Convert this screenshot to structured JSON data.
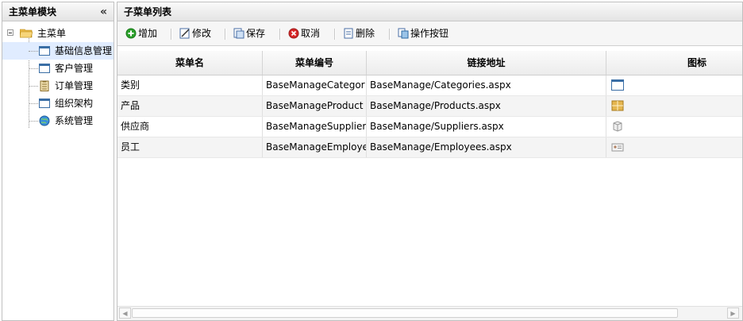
{
  "west": {
    "title": "主菜单模块",
    "collapse_glyph": "«",
    "root": {
      "label": "主菜单",
      "icon": "folder-open-icon"
    },
    "items": [
      {
        "label": "基础信息管理",
        "icon": "window-icon",
        "selected": true
      },
      {
        "label": "客户管理",
        "icon": "window-icon",
        "selected": false
      },
      {
        "label": "订单管理",
        "icon": "clipboard-icon",
        "selected": false
      },
      {
        "label": "组织架构",
        "icon": "window-icon",
        "selected": false
      },
      {
        "label": "系统管理",
        "icon": "globe-icon",
        "selected": false
      }
    ]
  },
  "center": {
    "title": "子菜单列表",
    "toolbar": {
      "add": "增加",
      "edit": "修改",
      "save": "保存",
      "cancel": "取消",
      "delete": "删除",
      "buttons": "操作按钮"
    },
    "columns": [
      "菜单名",
      "菜单编号",
      "链接地址",
      "图标"
    ],
    "rows": [
      {
        "name": "类别",
        "code": "BaseManageCategor",
        "url": "BaseManage/Categories.aspx",
        "icon": "window-icon"
      },
      {
        "name": "产品",
        "code": "BaseManageProduct",
        "url": "BaseManage/Products.aspx",
        "icon": "product-icon"
      },
      {
        "name": "供应商",
        "code": "BaseManageSupplier",
        "url": "BaseManage/Suppliers.aspx",
        "icon": "box-icon"
      },
      {
        "name": "员工",
        "code": "BaseManageEmploye",
        "url": "BaseManage/Employees.aspx",
        "icon": "id-card-icon"
      }
    ]
  },
  "colors": {
    "accent": "#99bbe8",
    "selected": "#e0ecff",
    "add_green": "#2ca02c",
    "cancel_red": "#d62728"
  }
}
